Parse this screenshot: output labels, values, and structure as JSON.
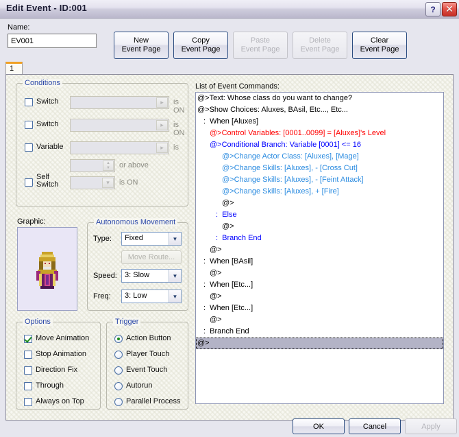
{
  "window": {
    "title": "Edit Event - ID:001",
    "help_button": "?",
    "close_button": "✕"
  },
  "name_field": {
    "label": "Name:",
    "value": "EV001"
  },
  "page_buttons": [
    {
      "line1": "New",
      "line2": "Event Page",
      "enabled": true
    },
    {
      "line1": "Copy",
      "line2": "Event Page",
      "enabled": true
    },
    {
      "line1": "Paste",
      "line2": "Event Page",
      "enabled": false
    },
    {
      "line1": "Delete",
      "line2": "Event Page",
      "enabled": false
    },
    {
      "line1": "Clear",
      "line2": "Event Page",
      "enabled": true
    }
  ],
  "tabs": [
    {
      "label": "1",
      "active": true
    }
  ],
  "conditions": {
    "title": "Conditions",
    "rows": [
      {
        "label": "Switch",
        "checked": false,
        "value": "",
        "suffix": "is ON"
      },
      {
        "label": "Switch",
        "checked": false,
        "value": "",
        "suffix": "is ON"
      },
      {
        "label": "Variable",
        "checked": false,
        "value": "",
        "suffix": "is"
      },
      {
        "label": "",
        "checked": null,
        "value": "",
        "suffix": "or above"
      },
      {
        "label": "Self Switch",
        "checked": false,
        "value": "",
        "suffix": "is ON"
      }
    ]
  },
  "graphic": {
    "label": "Graphic:",
    "sprite_name": "mage-robed-character-sprite"
  },
  "autonomous_movement": {
    "title": "Autonomous Movement",
    "type_label": "Type:",
    "type_value": "Fixed",
    "move_route_label": "Move Route...",
    "move_route_enabled": false,
    "speed_label": "Speed:",
    "speed_value": "3: Slow",
    "freq_label": "Freq:",
    "freq_value": "3: Low"
  },
  "options": {
    "title": "Options",
    "items": [
      {
        "label": "Move Animation",
        "checked": true
      },
      {
        "label": "Stop Animation",
        "checked": false
      },
      {
        "label": "Direction Fix",
        "checked": false
      },
      {
        "label": "Through",
        "checked": false
      },
      {
        "label": "Always on Top",
        "checked": false
      }
    ]
  },
  "trigger": {
    "title": "Trigger",
    "items": [
      {
        "label": "Action Button",
        "selected": true
      },
      {
        "label": "Player Touch",
        "selected": false
      },
      {
        "label": "Event Touch",
        "selected": false
      },
      {
        "label": "Autorun",
        "selected": false
      },
      {
        "label": "Parallel Process",
        "selected": false
      }
    ]
  },
  "command_list": {
    "title": "List of Event Commands:",
    "lines": [
      {
        "text": "@>Text: Whose class do you want to change?",
        "indent": 0,
        "color": "#000000",
        "selected": false
      },
      {
        "text": "@>Show Choices: Aluxes, BAsil, Etc..., Etc...",
        "indent": 0,
        "color": "#000000",
        "selected": false
      },
      {
        "text": ":  When [Aluxes]",
        "indent": 1,
        "color": "#000000",
        "selected": false
      },
      {
        "text": "@>Control Variables: [0001..0099] = [Aluxes]'s Level",
        "indent": 2,
        "color": "#FF0000",
        "selected": false
      },
      {
        "text": "@>Conditional Branch: Variable [0001] <= 16",
        "indent": 2,
        "color": "#0000FF",
        "selected": false
      },
      {
        "text": "@>Change Actor Class: [Aluxes], [Mage]",
        "indent": 4,
        "color": "#2A8BE0",
        "selected": false
      },
      {
        "text": "@>Change Skills: [Aluxes], - [Cross Cut]",
        "indent": 4,
        "color": "#2A8BE0",
        "selected": false
      },
      {
        "text": "@>Change Skills: [Aluxes], - [Feint Attack]",
        "indent": 4,
        "color": "#2A8BE0",
        "selected": false
      },
      {
        "text": "@>Change Skills: [Aluxes], + [Fire]",
        "indent": 4,
        "color": "#2A8BE0",
        "selected": false
      },
      {
        "text": "@>",
        "indent": 4,
        "color": "#000000",
        "selected": false
      },
      {
        "text": ":  Else",
        "indent": 3,
        "color": "#0000FF",
        "selected": false
      },
      {
        "text": "@>",
        "indent": 4,
        "color": "#000000",
        "selected": false
      },
      {
        "text": ":  Branch End",
        "indent": 3,
        "color": "#0000FF",
        "selected": false
      },
      {
        "text": "@>",
        "indent": 2,
        "color": "#000000",
        "selected": false
      },
      {
        "text": ":  When [BAsil]",
        "indent": 1,
        "color": "#000000",
        "selected": false
      },
      {
        "text": "@>",
        "indent": 2,
        "color": "#000000",
        "selected": false
      },
      {
        "text": ":  When [Etc...]",
        "indent": 1,
        "color": "#000000",
        "selected": false
      },
      {
        "text": "@>",
        "indent": 2,
        "color": "#000000",
        "selected": false
      },
      {
        "text": ":  When [Etc...]",
        "indent": 1,
        "color": "#000000",
        "selected": false
      },
      {
        "text": "@>",
        "indent": 2,
        "color": "#000000",
        "selected": false
      },
      {
        "text": ":  Branch End",
        "indent": 1,
        "color": "#000000",
        "selected": false
      },
      {
        "text": "@>",
        "indent": 0,
        "color": "#000000",
        "selected": true
      }
    ]
  },
  "footer": {
    "ok": "OK",
    "cancel": "Cancel",
    "apply": "Apply",
    "apply_enabled": false
  },
  "colors": {
    "accent": "#2a47a8",
    "tab_highlight": "#f0a024",
    "close_button": "#c42f26",
    "selection": "#b3b3c6"
  }
}
